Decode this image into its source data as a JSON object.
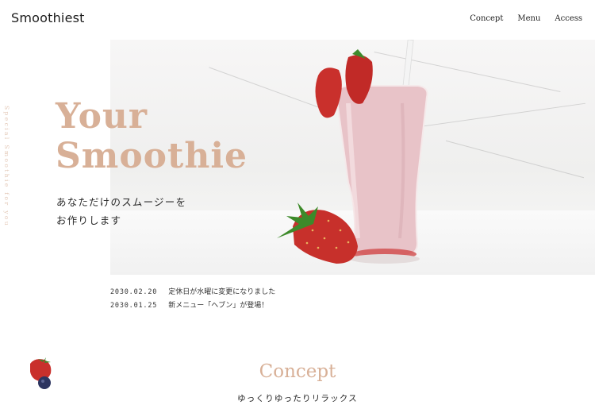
{
  "header": {
    "logo": "Smoothiest",
    "nav": [
      "Concept",
      "Menu",
      "Access"
    ]
  },
  "vertical_tagline": "Special Smoothie for you",
  "hero": {
    "title_line1": "Your",
    "title_line2": "Smoothie",
    "subtitle_line1": "あなただけのスムージーを",
    "subtitle_line2": "お作りします",
    "image": "strawberry-smoothie-photo"
  },
  "news": [
    {
      "date": "2030.02.20",
      "text": "定休日が水曜に変更になりました"
    },
    {
      "date": "2030.01.25",
      "text": "新メニュー「ヘブン」が登場！"
    }
  ],
  "concept": {
    "title": "Concept",
    "subtitle": "ゆっくりゆったりリラックス"
  },
  "colors": {
    "accent": "#d8b097",
    "strawberry": "#c9302c",
    "smoothie": "#e8c3c8"
  }
}
